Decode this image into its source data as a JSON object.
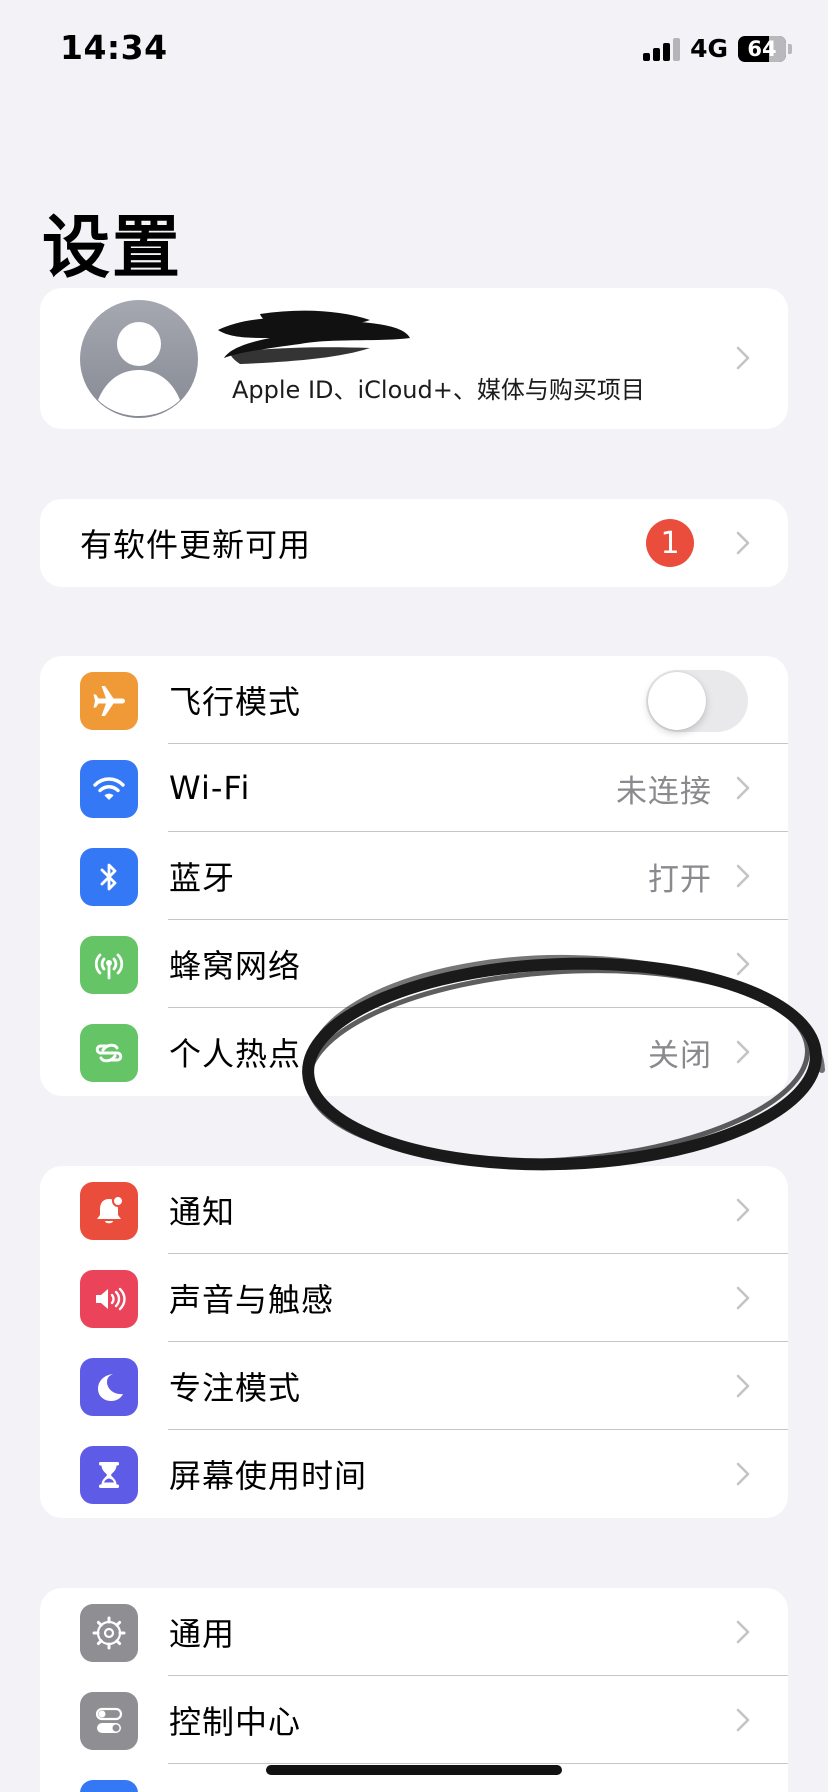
{
  "status_bar": {
    "time": "14:34",
    "network": "4G",
    "battery": "64",
    "battery_percent": 64,
    "signal_bars": 3
  },
  "page": {
    "title": "设置"
  },
  "profile": {
    "subtitle": "Apple ID、iCloud+、媒体与购买项目"
  },
  "update": {
    "label": "有软件更新可用",
    "badge": "1",
    "badge_color": "#eb4d3d"
  },
  "connectivity": [
    {
      "label": "飞行模式",
      "icon": "airplane-icon",
      "color": "#f09a37",
      "toggle": false
    },
    {
      "label": "Wi-Fi",
      "icon": "wifi-icon",
      "color": "#3478f6",
      "value": "未连接"
    },
    {
      "label": "蓝牙",
      "icon": "bluetooth-icon",
      "color": "#3478f6",
      "value": "打开"
    },
    {
      "label": "蜂窝网络",
      "icon": "cellular-icon",
      "color": "#65c466",
      "value": ""
    },
    {
      "label": "个人热点",
      "icon": "hotspot-icon",
      "color": "#65c466",
      "value": "关闭"
    }
  ],
  "notifications": [
    {
      "label": "通知",
      "icon": "notification-bell-icon",
      "color": "#eb4d3d"
    },
    {
      "label": "声音与触感",
      "icon": "speaker-icon",
      "color": "#eb445a"
    },
    {
      "label": "专注模式",
      "icon": "moon-icon",
      "color": "#5e5ce6"
    },
    {
      "label": "屏幕使用时间",
      "icon": "hourglass-icon",
      "color": "#5e5ce6"
    }
  ],
  "general": [
    {
      "label": "通用",
      "icon": "gear-icon",
      "color": "#8e8e93"
    },
    {
      "label": "控制中心",
      "icon": "switches-icon",
      "color": "#8e8e93"
    }
  ],
  "colors": {
    "background": "#f2f2f7",
    "card": "#ffffff",
    "separator": "#c6c6c8",
    "secondary_text": "#8a8a8e"
  }
}
